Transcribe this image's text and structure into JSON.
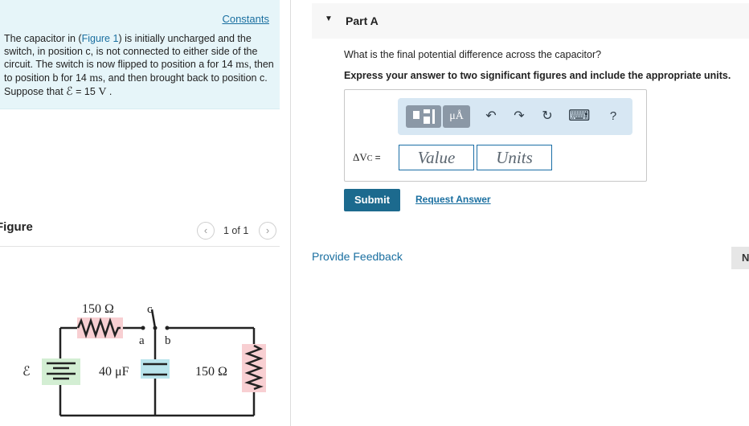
{
  "problem": {
    "constants_link": "Constants",
    "text_1": "The capacitor in (",
    "figure_link": "Figure 1",
    "text_2": ") is initially uncharged and the switch, in position c, is not connected to either side of the circuit. The switch is now flipped to position a for",
    "time_1": "14",
    "unit_1": "ms",
    "text_3": ", then to position b for",
    "time_2": "14",
    "unit_2": "ms",
    "text_4": ", and then brought back to position c. Suppose that",
    "emf_symbol": "ℰ",
    "emf_eq": "=",
    "emf_value": "15",
    "emf_unit": "V",
    "text_end": "."
  },
  "figure": {
    "title": "Figure",
    "prev_icon": "‹",
    "next_icon": "›",
    "page": "1 of 1",
    "labels": {
      "r1": "150 Ω",
      "c_pos": "c",
      "a_pos": "a",
      "b_pos": "b",
      "emf": "ℰ",
      "cap": "40 μF",
      "r2": "150 Ω"
    },
    "colors": {
      "resistor_highlight": "#f8cfd2",
      "capacitor_highlight": "#b9e4ec",
      "battery_highlight": "#d3eed3"
    }
  },
  "part": {
    "toggle_icon": "▼",
    "title": "Part A",
    "question": "What is the final potential difference across the capacitor?",
    "instruction": "Express your answer to two significant figures and include the appropriate units."
  },
  "toolbar": {
    "units_button": "μÅ",
    "undo_icon": "↶",
    "redo_icon": "↷",
    "reset_icon": "↻",
    "keyboard_icon": "⌨",
    "help_icon": "?"
  },
  "answer": {
    "label_delta": "ΔV",
    "label_sub": "C",
    "label_eq": "=",
    "value_placeholder": "Value",
    "units_placeholder": "Units"
  },
  "actions": {
    "submit": "Submit",
    "request_answer": "Request Answer",
    "feedback": "Provide Feedback",
    "next": "N"
  },
  "colors": {
    "accent": "#1c6a8e",
    "link": "#1a6fa0",
    "problem_bg": "#e6f5f9",
    "toolbar_bg": "#d7e7f3"
  }
}
